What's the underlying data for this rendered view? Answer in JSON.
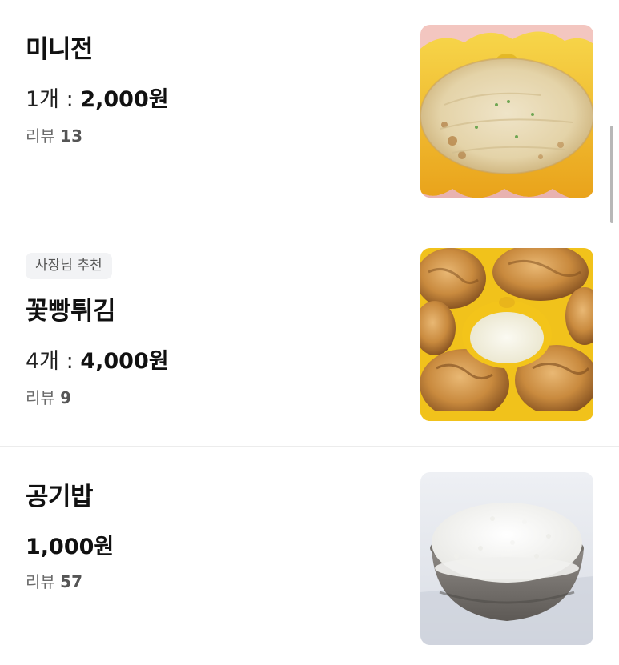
{
  "menu": {
    "items": [
      {
        "name": "미니전",
        "quantity": "1개",
        "separator": ":",
        "price": "2,000원",
        "review_label": "리뷰",
        "review_count": "13",
        "image": "scallion-pancake-photo"
      },
      {
        "badge": "사장님 추천",
        "name": "꽃빵튀김",
        "quantity": "4개",
        "separator": ":",
        "price": "4,000원",
        "review_label": "리뷰",
        "review_count": "9",
        "image": "fried-flower-bun-photo"
      },
      {
        "name": "공기밥",
        "price": "1,000원",
        "review_label": "리뷰",
        "review_count": "57",
        "image": "steamed-rice-bowl-photo"
      }
    ]
  },
  "colors": {
    "text_primary": "#111111",
    "text_secondary": "#6b6b6b",
    "badge_bg": "#f2f3f5",
    "divider": "#ececec",
    "plate_yellow": "#f5c400"
  }
}
